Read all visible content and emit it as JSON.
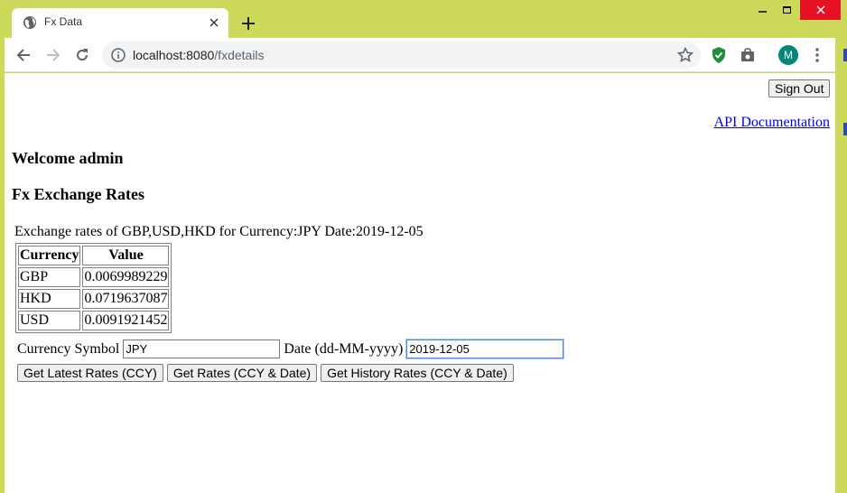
{
  "browser": {
    "tab_title": "Fx Data",
    "url_host": "localhost:8080",
    "url_path": "/fxdetails",
    "avatar_initial": "M"
  },
  "page": {
    "signout_label": "Sign Out",
    "api_link": "API Documentation",
    "welcome": "Welcome admin",
    "heading": "Fx Exchange Rates",
    "rates_description": "Exchange rates of GBP,USD,HKD for Currency:JPY Date:2019-12-05",
    "table": {
      "headers": [
        "Currency",
        "Value"
      ],
      "rows": [
        [
          "GBP",
          "0.0069989229"
        ],
        [
          "HKD",
          "0.0719637087"
        ],
        [
          "USD",
          "0.0091921452"
        ]
      ]
    },
    "form": {
      "currency_label": "Currency Symbol",
      "currency_value": "JPY",
      "date_label": "Date (dd-MM-yyyy)",
      "date_value": "2019-12-05"
    },
    "buttons": {
      "latest": "Get Latest Rates (CCY)",
      "by_date": "Get Rates (CCY & Date)",
      "history": "Get History Rates (CCY & Date)"
    }
  },
  "colors": {
    "frame": "#cdd95a",
    "link": "#0000ee",
    "close_button": "#e81123"
  }
}
